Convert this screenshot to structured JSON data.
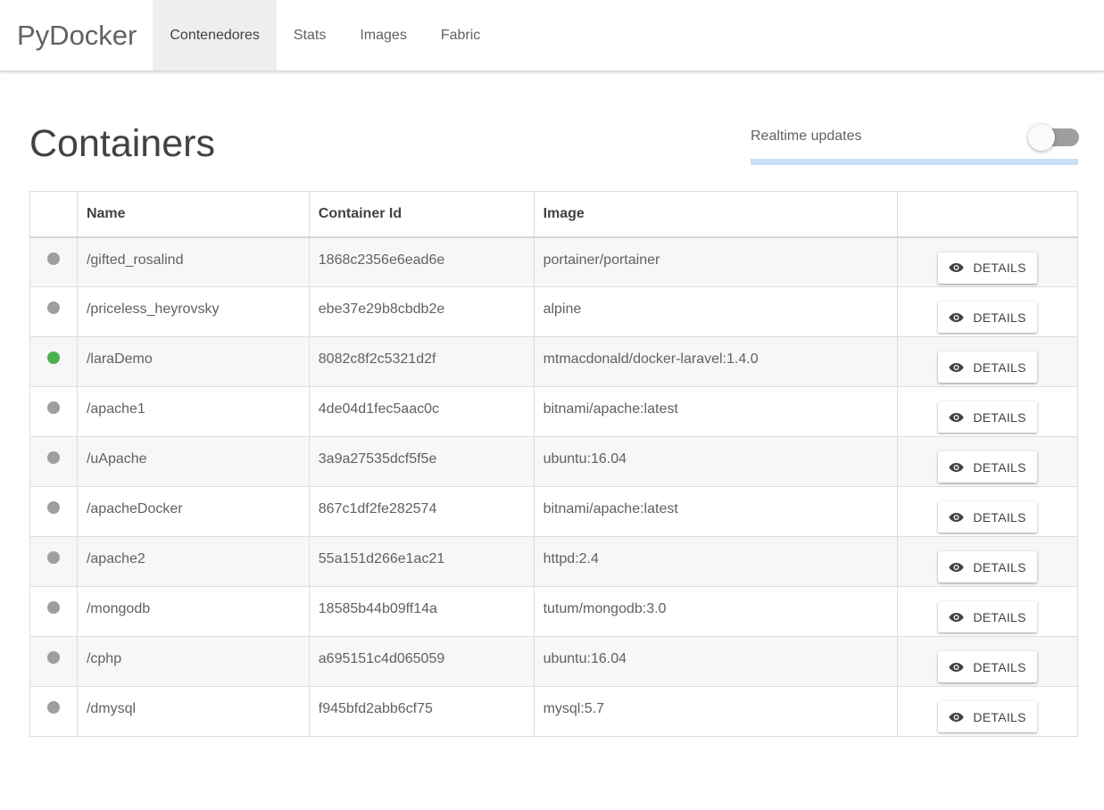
{
  "navbar": {
    "brand": "PyDocker",
    "items": [
      {
        "label": "Contenedores",
        "active": true
      },
      {
        "label": "Stats",
        "active": false
      },
      {
        "label": "Images",
        "active": false
      },
      {
        "label": "Fabric",
        "active": false
      }
    ]
  },
  "main": {
    "title": "Containers",
    "realtime": {
      "label": "Realtime updates",
      "enabled": false
    }
  },
  "table": {
    "columns": [
      "",
      "Name",
      "Container Id",
      "Image",
      ""
    ],
    "button_label": "DETAILS",
    "button_icon": "eye-icon",
    "status_colors": {
      "running": "#4caf50",
      "stopped": "#9e9e9e"
    },
    "rows": [
      {
        "status": "stopped",
        "name": "/gifted_rosalind",
        "id": "1868c2356e6ead6e",
        "image": "portainer/portainer"
      },
      {
        "status": "stopped",
        "name": "/priceless_heyrovsky",
        "id": "ebe37e29b8cbdb2e",
        "image": "alpine"
      },
      {
        "status": "running",
        "name": "/laraDemo",
        "id": "8082c8f2c5321d2f",
        "image": "mtmacdonald/docker-laravel:1.4.0"
      },
      {
        "status": "stopped",
        "name": "/apache1",
        "id": "4de04d1fec5aac0c",
        "image": "bitnami/apache:latest"
      },
      {
        "status": "stopped",
        "name": "/uApache",
        "id": "3a9a27535dcf5f5e",
        "image": "ubuntu:16.04"
      },
      {
        "status": "stopped",
        "name": "/apacheDocker",
        "id": "867c1df2fe282574",
        "image": "bitnami/apache:latest"
      },
      {
        "status": "stopped",
        "name": "/apache2",
        "id": "55a151d266e1ac21",
        "image": "httpd:2.4"
      },
      {
        "status": "stopped",
        "name": "/mongodb",
        "id": "18585b44b09ff14a",
        "image": "tutum/mongodb:3.0"
      },
      {
        "status": "stopped",
        "name": "/cphp",
        "id": "a695151c4d065059",
        "image": "ubuntu:16.04"
      },
      {
        "status": "stopped",
        "name": "/dmysql",
        "id": "f945bfd2abb6cf75",
        "image": "mysql:5.7"
      }
    ]
  }
}
